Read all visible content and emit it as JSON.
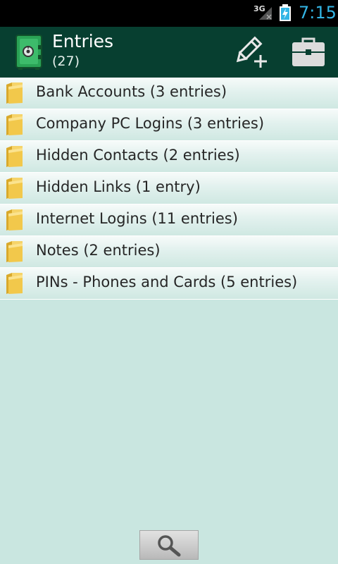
{
  "status_bar": {
    "network": "3G",
    "time": "7:15",
    "colors": {
      "time": "#33b5e5"
    }
  },
  "action_bar": {
    "title": "Entries",
    "subtitle": "(27)",
    "background": "#073f30",
    "icons": [
      "safe-app-icon",
      "edit-add-icon",
      "briefcase-icon"
    ]
  },
  "folders": [
    {
      "label": "Bank Accounts (3 entries)"
    },
    {
      "label": "Company PC Logins (3 entries)"
    },
    {
      "label": "Hidden Contacts (2 entries)"
    },
    {
      "label": "Hidden Links (1 entry)"
    },
    {
      "label": "Internet Logins (11 entries)"
    },
    {
      "label": "Notes (2 entries)"
    },
    {
      "label": "PINs - Phones and Cards (5 entries)"
    }
  ],
  "bottom": {
    "search_icon": "search-icon"
  },
  "colors": {
    "background": "#c9e6e0",
    "folder": "#f2c84b"
  }
}
